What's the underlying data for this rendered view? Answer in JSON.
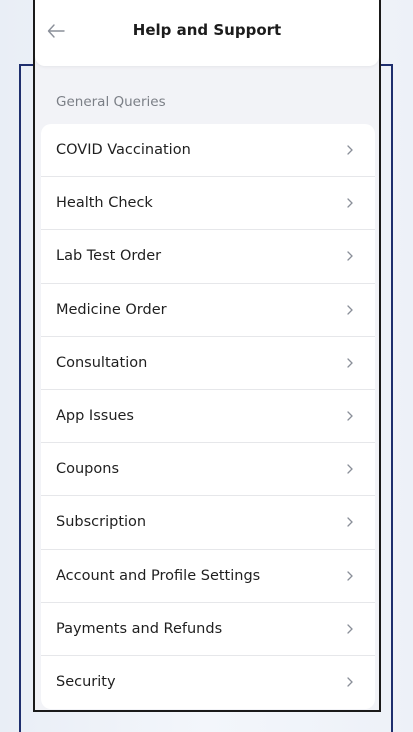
{
  "header": {
    "title": "Help and Support"
  },
  "section": {
    "label": "General Queries"
  },
  "items": [
    {
      "label": "COVID Vaccination"
    },
    {
      "label": "Health Check"
    },
    {
      "label": "Lab Test Order"
    },
    {
      "label": "Medicine Order"
    },
    {
      "label": "Consultation"
    },
    {
      "label": "App Issues"
    },
    {
      "label": "Coupons"
    },
    {
      "label": "Subscription"
    },
    {
      "label": "Account and Profile Settings"
    },
    {
      "label": "Payments and Refunds"
    },
    {
      "label": "Security"
    }
  ],
  "colors": {
    "frame": "#1f2f6e",
    "screen_background": "#f2f3f7",
    "card": "#ffffff"
  },
  "icons": {
    "back": "arrow-left-icon",
    "row": "chevron-right-icon"
  }
}
